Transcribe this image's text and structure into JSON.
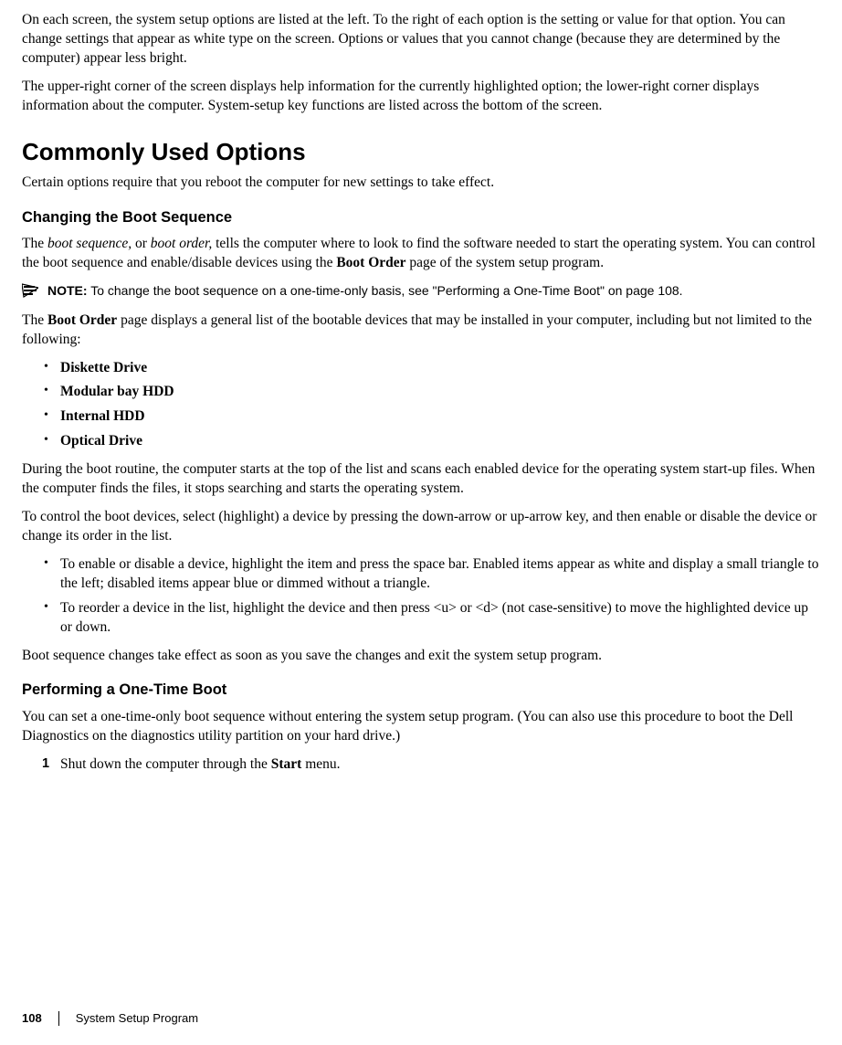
{
  "intro": {
    "p1": "On each screen, the system setup options are listed at the left. To the right of each option is the setting or value for that option. You can change settings that appear as white type on the screen. Options or values that you cannot change (because they are determined by the computer) appear less bright.",
    "p2": "The upper-right corner of the screen displays help information for the currently highlighted option; the lower-right corner displays information about the computer. System-setup key functions are listed across the bottom of the screen."
  },
  "section1": {
    "heading": "Commonly Used Options",
    "p1": "Certain options require that you reboot the computer for new settings to take effect."
  },
  "bootseq": {
    "heading": "Changing the Boot Sequence",
    "p1_a": "The ",
    "p1_i1": "boot sequence,",
    "p1_b": " or ",
    "p1_i2": "boot order,",
    "p1_c": " tells the computer where to look to find the software needed to start the operating system. You can control the boot sequence and enable/disable devices using the ",
    "p1_bold": "Boot Order",
    "p1_d": " page of the system setup program.",
    "note_label": "NOTE:",
    "note_text": " To change the boot sequence on a one-time-only basis, see \"Performing a One-Time Boot\" on page 108.",
    "p2_a": "The ",
    "p2_bold": "Boot Order",
    "p2_b": " page displays a general list of the bootable devices that may be installed in your computer, including but not limited to the following:",
    "devices": [
      "Diskette Drive",
      "Modular bay HDD",
      "Internal HDD",
      "Optical Drive"
    ],
    "p3": "During the boot routine, the computer starts at the top of the list and scans each enabled device for the operating system start-up files. When the computer finds the files, it stops searching and starts the operating system.",
    "p4": "To control the boot devices, select (highlight) a device by pressing the down-arrow or up-arrow key, and then enable or disable the device or change its order in the list.",
    "controls": [
      "To enable or disable a device, highlight the item and press the space bar. Enabled items appear as white and display a small triangle to the left; disabled items appear blue or dimmed without a triangle.",
      "To reorder a device in the list, highlight the device and then press <u> or <d> (not case-sensitive) to move the highlighted device up or down."
    ],
    "p5": "Boot sequence changes take effect as soon as you save the changes and exit the system setup program."
  },
  "onetime": {
    "heading": "Performing a One-Time Boot",
    "p1": "You can set a one-time-only boot sequence without entering the system setup program. (You can also use this procedure to boot the Dell Diagnostics on the diagnostics utility partition on your hard drive.)",
    "step1_num": "1",
    "step1_a": "Shut down the computer through the ",
    "step1_bold": "Start",
    "step1_b": " menu."
  },
  "footer": {
    "page": "108",
    "section": "System Setup Program"
  }
}
